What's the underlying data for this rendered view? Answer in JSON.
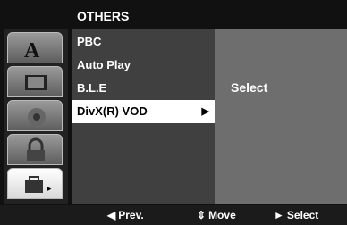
{
  "header": {
    "title": "OTHERS"
  },
  "tabs": [
    {
      "icon": "letter-a-icon",
      "active": false
    },
    {
      "icon": "screen-icon",
      "active": false
    },
    {
      "icon": "speaker-icon",
      "active": false
    },
    {
      "icon": "lock-icon",
      "active": false
    },
    {
      "icon": "others-toolbox-icon",
      "active": true
    }
  ],
  "menu": {
    "items": [
      {
        "label": "PBC"
      },
      {
        "label": "Auto Play"
      },
      {
        "label": "B.L.E"
      },
      {
        "label": "DivX(R) VOD",
        "selected": true,
        "arrow": "▶"
      }
    ]
  },
  "value_panel": {
    "text": "Select"
  },
  "footer": {
    "prev": {
      "icon": "◀",
      "label": "Prev."
    },
    "move": {
      "icon": "⇕",
      "label": "Move"
    },
    "select": {
      "icon": "►",
      "label": "Select"
    }
  }
}
